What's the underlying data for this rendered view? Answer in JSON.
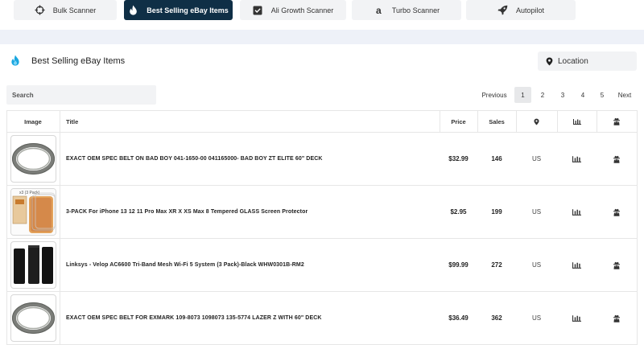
{
  "nav": {
    "tabs": [
      {
        "label": "Bulk Scanner",
        "icon": "crosshair-icon"
      },
      {
        "label": "Best Selling eBay Items",
        "icon": "flame-icon"
      },
      {
        "label": "Ali Growth Scanner",
        "icon": "inbox-check-icon"
      },
      {
        "label": "Turbo Scanner",
        "icon": "amazon-icon"
      },
      {
        "label": "Autopilot",
        "icon": "rocket-icon"
      }
    ],
    "active_index": 1
  },
  "header": {
    "title": "Best Selling eBay Items",
    "location_label": "Location"
  },
  "search": {
    "placeholder": "Search"
  },
  "pagination": {
    "previous": "Previous",
    "pages": [
      "1",
      "2",
      "3",
      "4",
      "5"
    ],
    "current": "1",
    "next": "Next"
  },
  "table": {
    "columns": {
      "image": "Image",
      "title": "Title",
      "price": "Price",
      "sales": "Sales"
    },
    "rows": [
      {
        "title": "EXACT OEM SPEC BELT ON BAD BOY 041-1650-00 041165000- BAD BOY ZT ELITE 60\" DECK",
        "price": "$32.99",
        "sales": "146",
        "country": "US",
        "thumb": "belt"
      },
      {
        "title": "3-PACK For iPhone 13 12 11 Pro Max XR X XS Max 8 Tempered GLASS Screen Protector",
        "price": "$2.95",
        "sales": "199",
        "country": "US",
        "thumb": "screen-protector"
      },
      {
        "title": "Linksys - Velop AC6600 Tri-Band Mesh Wi-Fi 5 System (3 Pack)-Black WHW0301B-RM2",
        "price": "$99.99",
        "sales": "272",
        "country": "US",
        "thumb": "router"
      },
      {
        "title": "EXACT OEM SPEC BELT FOR EXMARK 109-8073 1098073 135-5774 LAZER Z WITH 60\" DECK",
        "price": "$36.49",
        "sales": "362",
        "country": "US",
        "thumb": "belt"
      }
    ]
  },
  "colors": {
    "active_tab": "#0f2f46",
    "accent_flame": "#1aa7e0",
    "band": "#eef1f8",
    "button_bg": "#f2f3f5"
  }
}
